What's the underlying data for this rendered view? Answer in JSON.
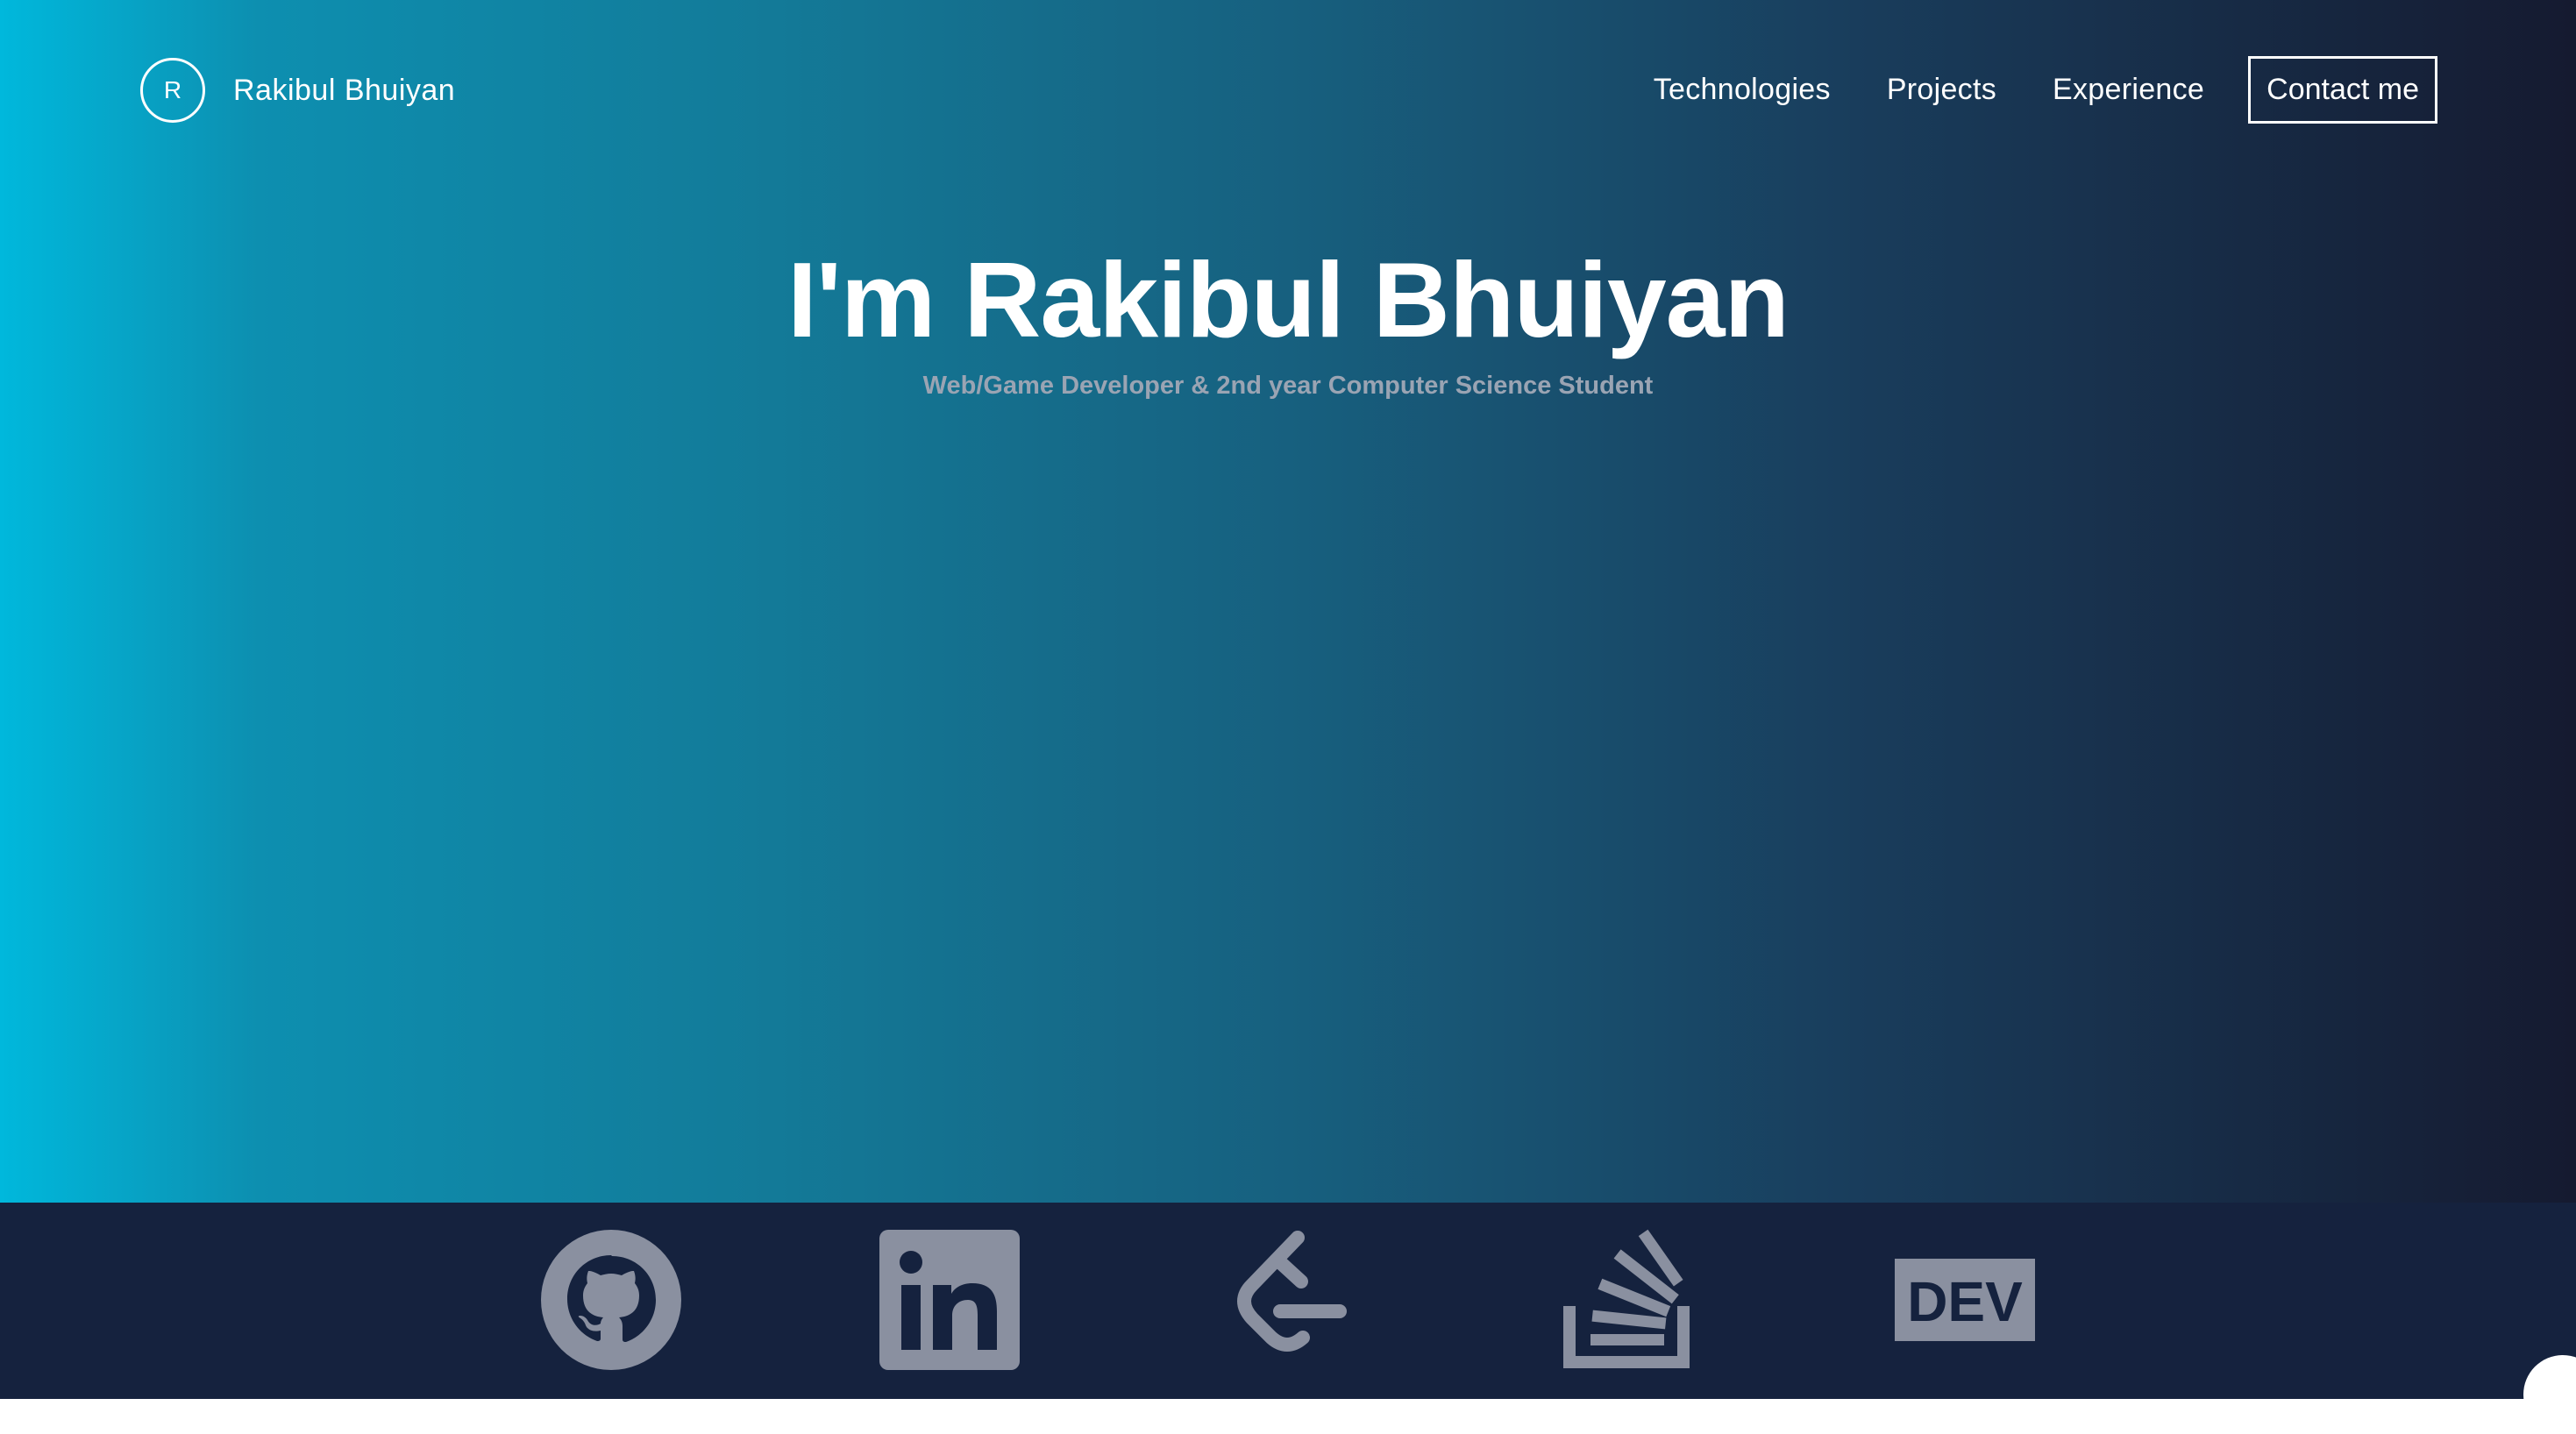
{
  "header": {
    "logo_initial": "R",
    "logo_name": "Rakibul Bhuiyan",
    "nav": [
      "Technologies",
      "Projects",
      "Experience"
    ],
    "contact_label": "Contact me"
  },
  "hero": {
    "title": "I'm Rakibul Bhuiyan",
    "subtitle": "Web/Game Developer & 2nd year Computer Science Student"
  },
  "socials": [
    {
      "icon": "github-icon"
    },
    {
      "icon": "linkedin-icon"
    },
    {
      "icon": "leetcode-icon"
    },
    {
      "icon": "stackoverflow-icon"
    },
    {
      "icon": "dev-icon",
      "label": "DEV"
    }
  ],
  "colors": {
    "gradient_start": "#00b8dc",
    "gradient_end": "#151a30",
    "footer_bg": "#15223e",
    "icon_color": "#8a90a0"
  }
}
